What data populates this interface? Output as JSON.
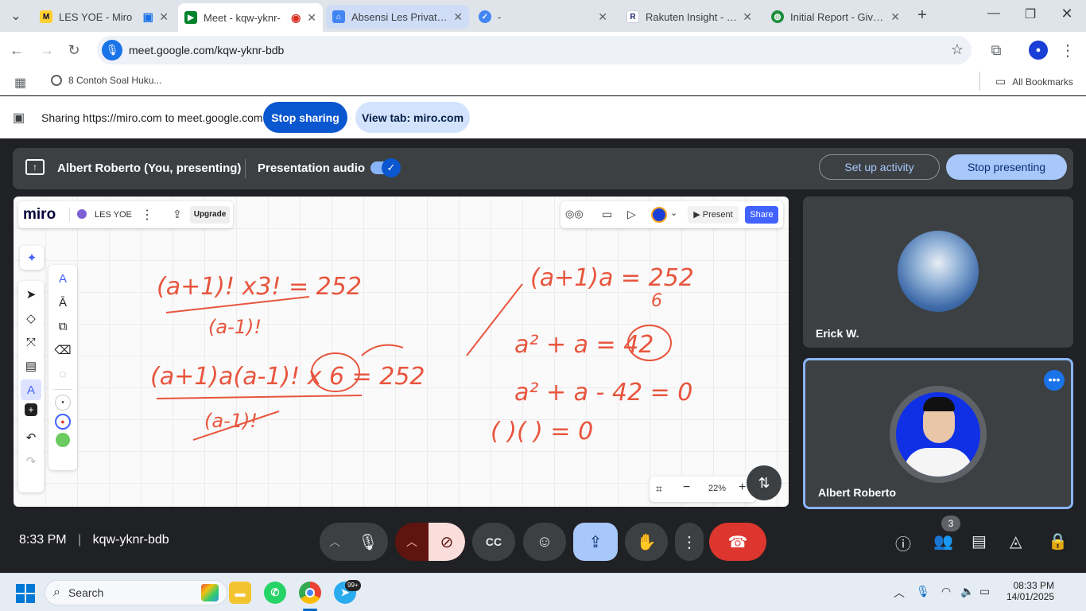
{
  "browser": {
    "tabs": [
      {
        "title": "LES YOE - Miro",
        "icon": "miro-tab-icon"
      },
      {
        "title": "Meet - kqw-yknr-",
        "icon": "google-meet-tab-icon"
      },
      {
        "title": "Absensi Les Privat – S",
        "icon": "google-sites-tab-icon"
      },
      {
        "title": "-",
        "icon": "checkmark-tab-icon"
      },
      {
        "title": "Rakuten Insight - Sur",
        "icon": "rakuten-tab-icon"
      },
      {
        "title": "Initial Report - Give u",
        "icon": "globe-tab-icon"
      }
    ],
    "url": "meet.google.com/kqw-yknr-bdb",
    "bookmark": "8 Contoh Soal Huku...",
    "all_bookmarks": "All Bookmarks"
  },
  "sharing": {
    "text": "Sharing https://miro.com to meet.google.com",
    "stop_sharing": "Stop sharing",
    "view_tab": "View tab: miro.com"
  },
  "meet": {
    "presenter": "Albert Roberto (You, presenting)",
    "presentation_audio": "Presentation audio",
    "setup_activity": "Set up activity",
    "stop_presenting": "Stop presenting",
    "participants": [
      {
        "name": "Erick W."
      },
      {
        "name": "Albert Roberto"
      }
    ],
    "time": "8:33 PM",
    "meeting_code": "kqw-yknr-bdb",
    "participant_count": "3",
    "colors": {
      "accent": "#1a73e8",
      "end_call": "#ea4335",
      "present_active": "#a8c7fa"
    }
  },
  "miro": {
    "logo": "miro",
    "board_name": "LES YOE",
    "upgrade": "Upgrade",
    "present": "Present",
    "share": "Share",
    "zoom": "22%",
    "whiteboard": {
      "line1": "(a+1)! x3! = 252",
      "line1_den": "(a-1)!",
      "line2": "(a+1)a(a-1)! x 6 = 252",
      "line2_den": "(a-1)!",
      "right1": "(a+1)a = 252",
      "right1_den": "6",
      "right2": "a² + a = 42",
      "right3": "a² + a - 42 = 0",
      "right4": "(    )(    ) = 0"
    }
  },
  "taskbar": {
    "search": "Search",
    "time": "08:33 PM",
    "date": "14/01/2025",
    "telegram_badge": "99+"
  }
}
